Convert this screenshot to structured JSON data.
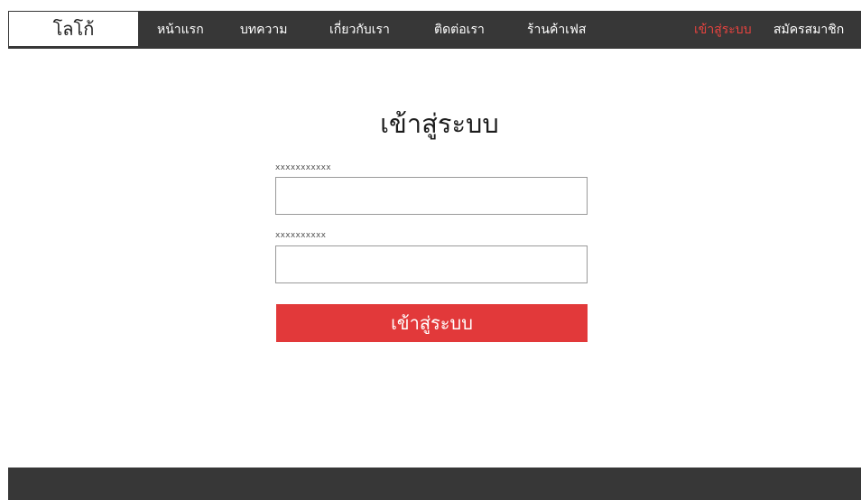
{
  "navbar": {
    "logo": "โลโก้",
    "items": [
      {
        "label": "หน้าแรก"
      },
      {
        "label": "บทความ"
      },
      {
        "label": "เกี่ยวกับเรา"
      },
      {
        "label": "ติดต่อเรา"
      },
      {
        "label": "ร้านค้าเฟส"
      }
    ],
    "login_link": "เข้าสู่ระบบ",
    "register_link": "สมัครสมาชิก"
  },
  "login_form": {
    "title": "เข้าสู่ระบบ",
    "username_label": "xxxxxxxxxxx",
    "username_value": "",
    "password_label": "xxxxxxxxxx",
    "password_value": "",
    "submit_label": "เข้าสู่ระบบ"
  },
  "colors": {
    "nav_background": "#373737",
    "accent_red": "#e2393a",
    "login_link": "#e8433f"
  }
}
